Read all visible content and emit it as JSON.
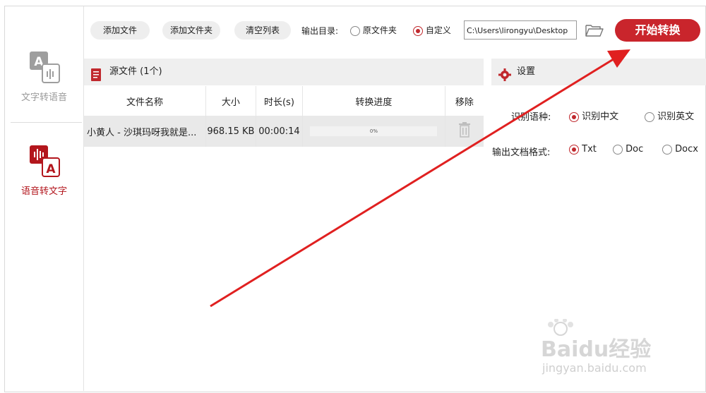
{
  "sidebar": {
    "items": [
      {
        "label": "文字转语音",
        "active": false
      },
      {
        "label": "语音转文字",
        "active": true
      }
    ]
  },
  "toolbar": {
    "add_file": "添加文件",
    "add_folder": "添加文件夹",
    "clear_list": "清空列表",
    "output_dir_label": "输出目录:",
    "option_source": "原文件夹",
    "option_custom": "自定义",
    "output_path": "C:\\Users\\lirongyu\\Desktop",
    "start": "开始转换"
  },
  "files_panel": {
    "title": "源文件 (1个)",
    "columns": [
      "文件名称",
      "大小",
      "时长(s)",
      "转换进度",
      "移除"
    ],
    "rows": [
      {
        "name": "小黄人 - 沙琪玛呀我就是...",
        "size": "968.15 KB",
        "duration": "00:00:14",
        "progress_text": "0%",
        "progress": 0
      }
    ]
  },
  "settings_panel": {
    "title": "设置",
    "language_label": "识别语种:",
    "language_options": [
      "识别中文",
      "识别英文"
    ],
    "language_selected": "识别中文",
    "format_label": "输出文档格式:",
    "format_options": [
      "Txt",
      "Doc",
      "Docx"
    ],
    "format_selected": "Txt"
  },
  "watermark": {
    "brand": "Baidu经验",
    "url": "jingyan.baidu.com"
  },
  "colors": {
    "accent": "#c9252c",
    "arrow": "#e02020",
    "panel_bg": "#efefef"
  }
}
